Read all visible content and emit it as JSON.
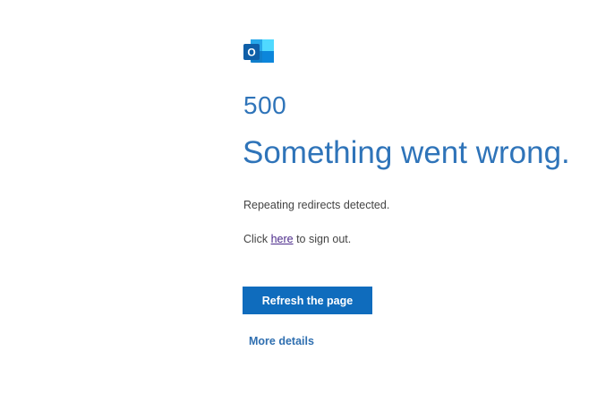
{
  "app": {
    "logo_icon": "outlook-logo-icon",
    "logo_letter": "O"
  },
  "error": {
    "code": "500",
    "headline": "Something went wrong.",
    "message": "Repeating redirects detected.",
    "signout_prefix": "Click ",
    "signout_link": "here",
    "signout_suffix": " to sign out."
  },
  "actions": {
    "refresh_label": "Refresh the page",
    "more_details_label": "More details"
  },
  "colors": {
    "accent": "#0f6cbd",
    "heading": "#2f74b9",
    "link_visited": "#4b2a8a"
  }
}
